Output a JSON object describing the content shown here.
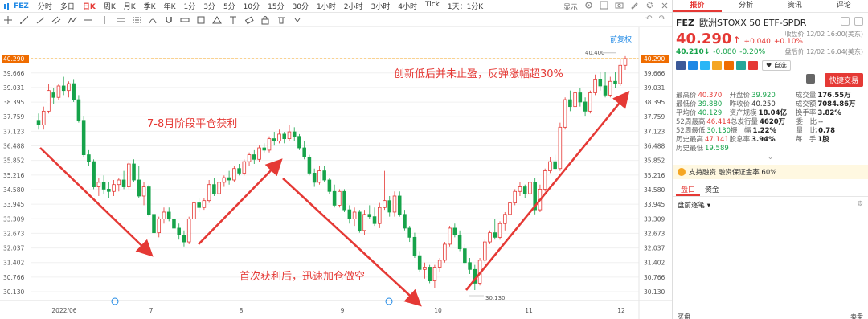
{
  "toolbar": {
    "symbol": "FEZ",
    "periods": [
      {
        "label": "分时",
        "active": false
      },
      {
        "label": "多日",
        "active": false
      },
      {
        "label": "日K",
        "active": true
      },
      {
        "label": "周K",
        "active": false
      },
      {
        "label": "月K",
        "active": false
      },
      {
        "label": "季K",
        "active": false
      },
      {
        "label": "年K",
        "active": false
      },
      {
        "label": "1分",
        "active": false
      },
      {
        "label": "3分",
        "active": false
      },
      {
        "label": "5分",
        "active": false
      },
      {
        "label": "10分",
        "active": false
      },
      {
        "label": "15分",
        "active": false
      },
      {
        "label": "30分",
        "active": false
      },
      {
        "label": "1小时",
        "active": false
      },
      {
        "label": "2小时",
        "active": false
      },
      {
        "label": "3小时",
        "active": false
      },
      {
        "label": "4小时",
        "active": false
      },
      {
        "label": "Tick",
        "active": false
      },
      {
        "label": "1天：1分K",
        "active": false
      }
    ],
    "display_label": "显示"
  },
  "chart": {
    "rehab_label": "前复权",
    "price_labels": [
      "40.290",
      "39.666",
      "39.031",
      "38.395",
      "37.759",
      "37.123",
      "36.488",
      "35.852",
      "35.216",
      "34.580",
      "33.945",
      "33.309",
      "32.673",
      "32.037",
      "31.402",
      "30.766",
      "30.130"
    ],
    "price_values": [
      40.29,
      39.666,
      39.031,
      38.395,
      37.759,
      37.123,
      36.488,
      35.852,
      35.216,
      34.58,
      33.945,
      33.309,
      32.673,
      32.037,
      31.402,
      30.766,
      30.13
    ],
    "current_price": 40.29,
    "date_labels": [
      "2022/06",
      "7",
      "8",
      "9",
      "10",
      "11",
      "12"
    ],
    "high_marker": "40.400",
    "low_marker": "30.130",
    "annotations": [
      {
        "text": "7-8月阶段平仓获利"
      },
      {
        "text": "首次获利后，迅速加仓做空"
      },
      {
        "text": "创新低后并未止盈，反弹涨幅超30%"
      }
    ],
    "colors": {
      "up": "#e53935",
      "down": "#16a34a",
      "annotation": "#e53935",
      "price_line": "#f5a623"
    }
  },
  "chart_data": {
    "type": "candlestick",
    "title": "",
    "ohlc": [
      [
        37.6,
        37.9,
        37.2,
        37.4
      ],
      [
        37.4,
        38.2,
        37.2,
        38.0
      ],
      [
        38.0,
        39.2,
        37.9,
        38.9
      ],
      [
        38.8,
        39.0,
        38.3,
        38.6
      ],
      [
        38.6,
        39.2,
        38.5,
        39.1
      ],
      [
        39.1,
        39.5,
        38.7,
        38.9
      ],
      [
        38.9,
        39.3,
        38.6,
        39.2
      ],
      [
        39.2,
        39.4,
        38.4,
        38.5
      ],
      [
        38.5,
        38.7,
        37.5,
        37.6
      ],
      [
        37.6,
        37.8,
        36.0,
        36.1
      ],
      [
        36.1,
        36.3,
        35.6,
        35.8
      ],
      [
        35.8,
        35.9,
        34.6,
        34.7
      ],
      [
        34.7,
        35.1,
        34.3,
        34.9
      ],
      [
        34.9,
        35.2,
        34.4,
        34.6
      ],
      [
        34.6,
        34.9,
        34.2,
        34.5
      ],
      [
        34.5,
        35.0,
        34.3,
        34.8
      ],
      [
        34.8,
        35.1,
        34.5,
        35.0
      ],
      [
        35.0,
        35.4,
        34.6,
        34.7
      ],
      [
        34.7,
        35.8,
        34.6,
        35.7
      ],
      [
        35.7,
        35.9,
        34.9,
        35.0
      ],
      [
        35.0,
        35.6,
        34.2,
        34.3
      ],
      [
        34.3,
        34.9,
        33.9,
        34.7
      ],
      [
        34.7,
        34.8,
        33.4,
        33.5
      ],
      [
        33.5,
        33.7,
        32.6,
        32.7
      ],
      [
        32.7,
        33.4,
        32.5,
        33.3
      ],
      [
        33.3,
        33.8,
        33.1,
        33.6
      ],
      [
        33.6,
        33.8,
        33.2,
        33.3
      ],
      [
        33.3,
        33.5,
        32.7,
        32.9
      ],
      [
        32.9,
        33.1,
        32.4,
        32.6
      ],
      [
        32.6,
        32.8,
        32.1,
        32.3
      ],
      [
        32.3,
        33.4,
        32.2,
        33.3
      ],
      [
        33.3,
        34.1,
        33.2,
        34.0
      ],
      [
        34.0,
        34.2,
        33.6,
        33.8
      ],
      [
        33.8,
        34.2,
        33.7,
        34.1
      ],
      [
        34.1,
        35.0,
        34.0,
        34.8
      ],
      [
        34.8,
        35.1,
        34.3,
        34.4
      ],
      [
        34.4,
        35.0,
        34.3,
        34.9
      ],
      [
        34.9,
        35.2,
        34.7,
        35.1
      ],
      [
        35.1,
        35.4,
        34.8,
        35.0
      ],
      [
        35.0,
        35.6,
        34.9,
        35.5
      ],
      [
        35.5,
        35.7,
        35.2,
        35.3
      ],
      [
        35.3,
        35.9,
        35.2,
        35.8
      ],
      [
        35.8,
        36.2,
        35.6,
        36.1
      ],
      [
        36.1,
        36.3,
        35.7,
        35.9
      ],
      [
        35.9,
        36.5,
        35.8,
        36.4
      ],
      [
        36.4,
        36.6,
        36.2,
        36.3
      ],
      [
        36.3,
        36.9,
        36.2,
        36.8
      ],
      [
        36.8,
        37.1,
        36.5,
        36.7
      ],
      [
        36.7,
        37.2,
        36.6,
        37.0
      ],
      [
        37.0,
        37.1,
        36.6,
        36.8
      ],
      [
        36.8,
        37.4,
        36.7,
        37.1
      ],
      [
        37.1,
        37.3,
        36.7,
        36.9
      ],
      [
        36.9,
        37.0,
        36.3,
        36.4
      ],
      [
        36.4,
        36.7,
        35.9,
        36.0
      ],
      [
        36.0,
        36.1,
        35.2,
        35.3
      ],
      [
        35.3,
        35.5,
        34.7,
        34.9
      ],
      [
        34.9,
        35.6,
        34.8,
        35.4
      ],
      [
        35.4,
        35.6,
        34.9,
        35.0
      ],
      [
        35.0,
        35.1,
        34.4,
        34.5
      ],
      [
        34.5,
        34.8,
        33.8,
        33.9
      ],
      [
        33.9,
        34.6,
        33.8,
        34.5
      ],
      [
        34.5,
        34.6,
        33.6,
        33.7
      ],
      [
        33.7,
        33.9,
        33.1,
        33.3
      ],
      [
        33.3,
        33.8,
        33.0,
        33.6
      ],
      [
        33.6,
        33.7,
        32.7,
        32.8
      ],
      [
        32.8,
        33.7,
        32.6,
        33.5
      ],
      [
        33.5,
        33.9,
        33.3,
        33.4
      ],
      [
        33.4,
        33.8,
        33.0,
        33.1
      ],
      [
        33.1,
        34.0,
        32.9,
        33.8
      ],
      [
        33.8,
        35.4,
        33.7,
        34.1
      ],
      [
        34.1,
        34.3,
        33.4,
        33.6
      ],
      [
        33.6,
        34.5,
        33.4,
        34.3
      ],
      [
        34.3,
        34.5,
        33.4,
        33.5
      ],
      [
        33.5,
        33.7,
        32.8,
        32.9
      ],
      [
        32.9,
        33.0,
        32.3,
        32.5
      ],
      [
        32.5,
        32.7,
        31.6,
        31.7
      ],
      [
        31.7,
        31.9,
        31.0,
        31.1
      ],
      [
        31.1,
        31.4,
        30.7,
        31.2
      ],
      [
        31.2,
        31.3,
        30.5,
        30.6
      ],
      [
        30.6,
        31.3,
        30.3,
        31.2
      ],
      [
        31.2,
        31.6,
        31.0,
        31.5
      ],
      [
        31.5,
        32.3,
        31.4,
        32.2
      ],
      [
        32.2,
        33.0,
        32.1,
        32.9
      ],
      [
        32.9,
        33.1,
        32.5,
        32.6
      ],
      [
        32.6,
        32.8,
        31.9,
        32.0
      ],
      [
        32.0,
        32.2,
        31.3,
        31.4
      ],
      [
        31.4,
        31.6,
        30.9,
        31.1
      ],
      [
        31.1,
        31.3,
        30.2,
        30.5
      ],
      [
        30.5,
        31.6,
        30.4,
        31.5
      ],
      [
        31.5,
        32.4,
        31.4,
        32.3
      ],
      [
        32.3,
        32.8,
        32.2,
        32.7
      ],
      [
        32.7,
        33.3,
        32.4,
        32.5
      ],
      [
        32.5,
        33.2,
        32.4,
        33.1
      ],
      [
        33.1,
        33.6,
        32.8,
        33.5
      ],
      [
        33.5,
        34.1,
        33.3,
        34.0
      ],
      [
        34.0,
        34.6,
        33.9,
        34.5
      ],
      [
        34.5,
        34.9,
        34.3,
        34.7
      ],
      [
        34.7,
        34.8,
        34.2,
        34.4
      ],
      [
        34.4,
        35.0,
        34.3,
        34.9
      ],
      [
        34.9,
        35.1,
        33.5,
        33.7
      ],
      [
        33.7,
        34.8,
        33.6,
        34.6
      ],
      [
        34.6,
        35.5,
        34.5,
        35.4
      ],
      [
        35.4,
        36.0,
        35.3,
        35.8
      ],
      [
        35.8,
        36.1,
        35.4,
        35.5
      ],
      [
        35.5,
        37.5,
        35.4,
        37.3
      ],
      [
        37.3,
        38.6,
        37.2,
        38.5
      ],
      [
        38.5,
        38.9,
        38.0,
        38.2
      ],
      [
        38.2,
        38.9,
        38.1,
        38.8
      ],
      [
        38.8,
        39.0,
        38.2,
        38.4
      ],
      [
        38.4,
        38.6,
        37.8,
        38.0
      ],
      [
        38.0,
        38.9,
        37.9,
        38.8
      ],
      [
        38.8,
        39.6,
        38.7,
        39.4
      ],
      [
        39.4,
        39.7,
        38.9,
        39.1
      ],
      [
        39.1,
        39.7,
        38.6,
        38.7
      ],
      [
        38.7,
        39.5,
        38.6,
        39.3
      ],
      [
        39.3,
        39.7,
        39.0,
        39.2
      ],
      [
        39.2,
        40.3,
        39.1,
        40.0
      ],
      [
        40.0,
        40.4,
        39.8,
        40.29
      ]
    ],
    "y_ticks": [
      40.29,
      39.666,
      39.031,
      38.395,
      37.759,
      37.123,
      36.488,
      35.852,
      35.216,
      34.58,
      33.945,
      33.309,
      32.673,
      32.037,
      31.402,
      30.766,
      30.13
    ],
    "x_ticks": [
      "2022/06",
      "7",
      "8",
      "9",
      "10",
      "11",
      "12"
    ],
    "high": 40.4,
    "low": 30.13
  },
  "panel": {
    "tabs": [
      {
        "label": "报价",
        "active": true
      },
      {
        "label": "分析",
        "active": false
      },
      {
        "label": "资讯",
        "active": false
      },
      {
        "label": "评论",
        "active": false
      }
    ],
    "symbol": "FEZ",
    "name": "欧洲STOXX 50 ETF-SPDR",
    "price": "40.290",
    "price_arrow": "↑",
    "change": "+0.040",
    "change_pct": "+0.10%",
    "close_time": "收盘价 12/02 16:00(美东)",
    "after_price": "40.210",
    "after_arrow": "↓",
    "after_change": "-0.080",
    "after_pct": "-0.20%",
    "after_time": "盘后价 12/02 16:04(美东)",
    "fav_label": "自选",
    "quick_trade_label": "快捷交易",
    "stats": [
      [
        {
          "lbl": "最高价",
          "val": "40.370",
          "cls": "red"
        },
        {
          "lbl": "开盘价",
          "val": "39.920",
          "cls": "green"
        },
        {
          "lbl": "成交量",
          "val": "176.55万",
          "cls": "blk"
        }
      ],
      [
        {
          "lbl": "最低价",
          "val": "39.880",
          "cls": "green"
        },
        {
          "lbl": "昨收价",
          "val": "40.250",
          "cls": ""
        },
        {
          "lbl": "成交额",
          "val": "7084.86万",
          "cls": "blk"
        }
      ],
      [
        {
          "lbl": "平均价",
          "val": "40.129",
          "cls": "green"
        },
        {
          "lbl": "资产规模",
          "val": "18.04亿",
          "cls": "blk"
        },
        {
          "lbl": "换手率",
          "val": "3.82%",
          "cls": "blk"
        }
      ],
      [
        {
          "lbl": "52周最高",
          "val": "46.414",
          "cls": "red"
        },
        {
          "lbl": "总发行量",
          "val": "4620万",
          "cls": "blk"
        },
        {
          "lbl": "委　比",
          "val": "--",
          "cls": ""
        }
      ],
      [
        {
          "lbl": "52周最低",
          "val": "30.130",
          "cls": "green"
        },
        {
          "lbl": "振　幅",
          "val": "1.22%",
          "cls": "blk"
        },
        {
          "lbl": "量　比",
          "val": "0.78",
          "cls": "blk"
        }
      ],
      [
        {
          "lbl": "历史最高",
          "val": "47.141",
          "cls": "red"
        },
        {
          "lbl": "股息率",
          "val": "3.94%",
          "cls": "blk"
        },
        {
          "lbl": "每　手",
          "val": "1股",
          "cls": "blk"
        }
      ],
      [
        {
          "lbl": "历史最低",
          "val": "19.589",
          "cls": "green"
        },
        {
          "lbl": "",
          "val": "",
          "cls": ""
        },
        {
          "lbl": "",
          "val": "",
          "cls": ""
        }
      ]
    ],
    "margin_text": "支持融资 融资保证金率 60%",
    "sub_tabs": [
      {
        "label": "盘口",
        "active": true
      },
      {
        "label": "资金",
        "active": false
      }
    ],
    "pankou_label": "盘前逐笔",
    "bottom_left": "买盘",
    "bottom_right": "卖盘"
  }
}
